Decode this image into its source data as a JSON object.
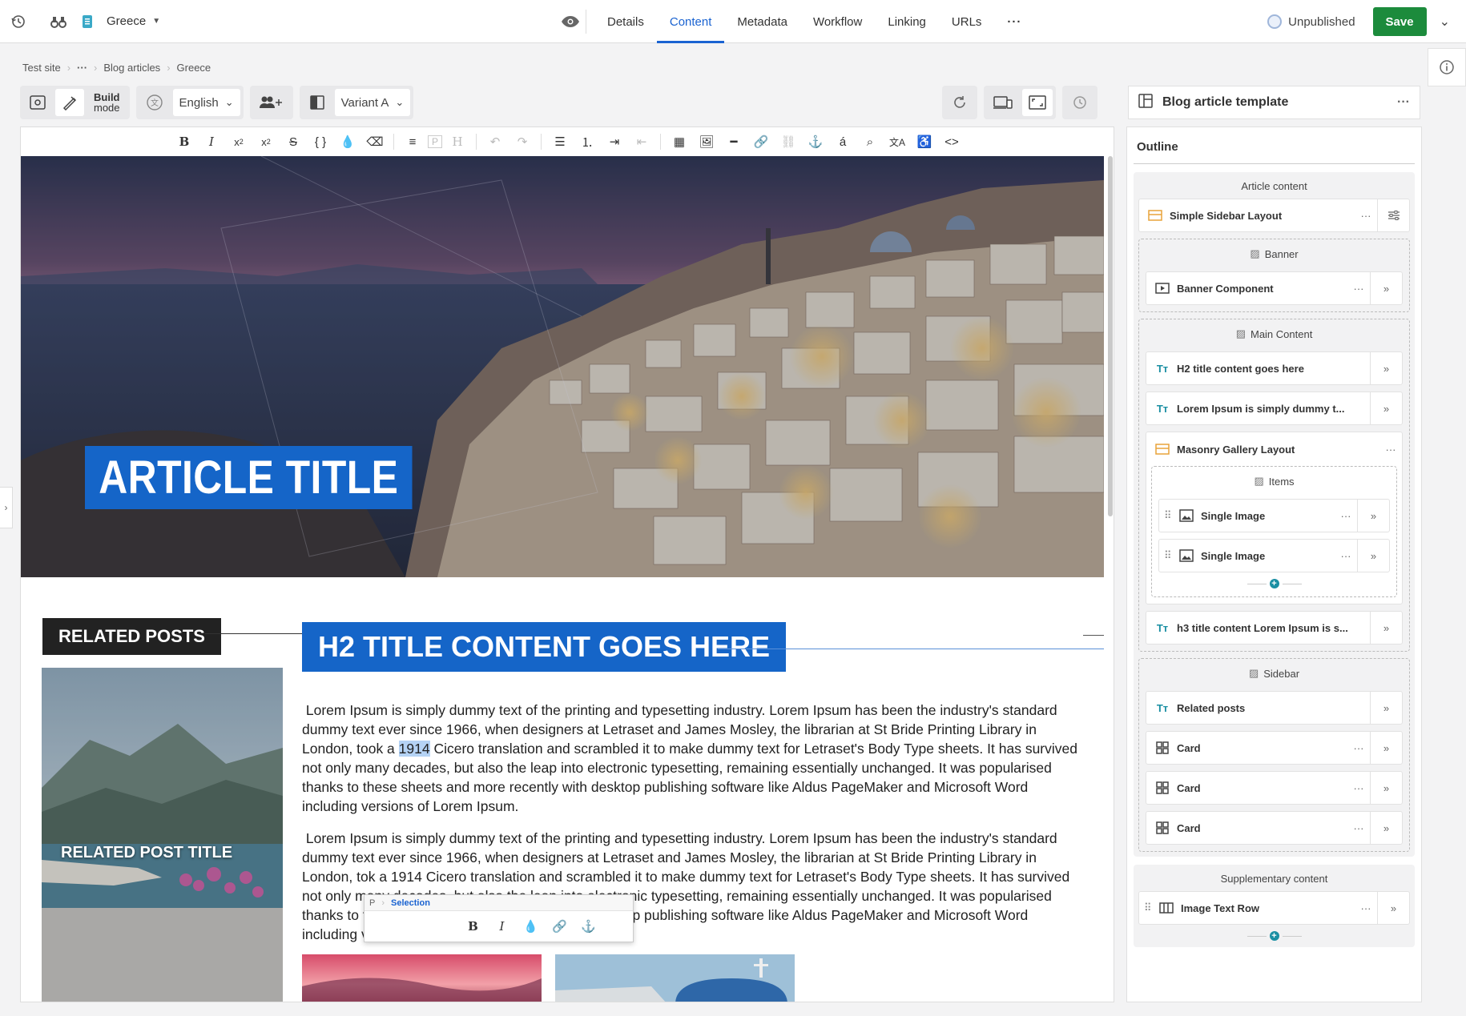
{
  "topbar": {
    "item_name": "Greece",
    "tabs": [
      "Details",
      "Content",
      "Metadata",
      "Workflow",
      "Linking",
      "URLs"
    ],
    "active_tab": "Content",
    "status": "Unpublished",
    "save_label": "Save"
  },
  "breadcrumb": [
    "Test site",
    "Blog articles",
    "Greece"
  ],
  "controls": {
    "build_mode_label_1": "Build",
    "build_mode_label_2": "mode",
    "language": "English",
    "variant": "Variant A"
  },
  "template": {
    "title": "Blog article template",
    "outline_title": "Outline"
  },
  "outline": {
    "article_content": "Article content",
    "layout": "Simple Sidebar Layout",
    "banner_zone": "Banner",
    "banner_component": "Banner Component",
    "main_zone": "Main Content",
    "main_items": [
      "H2 title content goes here",
      "Lorem Ipsum is simply dummy t..."
    ],
    "gallery": "Masonry Gallery Layout",
    "items_zone": "Items",
    "gallery_items": [
      "Single Image",
      "Single Image"
    ],
    "h3_item": "h3 title content Lorem Ipsum is s...",
    "sidebar_zone": "Sidebar",
    "related": "Related posts",
    "cards": [
      "Card",
      "Card",
      "Card"
    ],
    "supplementary": "Supplementary content",
    "image_text_row": "Image Text Row"
  },
  "canvas": {
    "article_title": "ARTICLE TITLE",
    "related_heading": "RELATED POSTS",
    "related_post_title": "RELATED POST TITLE",
    "h2_title": "H2 TITLE CONTENT GOES HERE",
    "p1_before": "Lorem Ipsum is simply dummy text of the printing and typesetting industry. Lorem Ipsum has been the industry's standard dummy text ever since 1966, when designers at Letraset and James Mosley, the librarian at St Bride Printing Library in London, took a ",
    "p1_highlight": "1914",
    "p1_after": " Cicero translation and scrambled it to make dummy text for Letraset's Body Type sheets. It has survived not only many decades, but also the leap into electronic typesetting, remaining essentially unchanged. It was popularised thanks to these sheets and more recently with desktop publishing software like Aldus PageMaker and Microsoft Word including versions of Lorem Ipsum.",
    "p2": "Lorem Ipsum is simply dummy text of the printing and typesetting industry. Lorem Ipsum has been the industry's standard dummy text ever since 1966, when designers at Letraset and James Mosley, the librarian at St Bride Printing Library in London, tok a 1914 Cicero translation and scrambled it to make dummy text for Letraset's Body Type sheets. It has survived not only many decades, but also the leap into electronic typesetting, remaining essentially unchanged. It was popularised thanks to these sheets and more recently with desktop publishing software like Aldus PageMaker and Microsoft Word including versions of Lorem Ipsum.",
    "popup_tag": "P",
    "popup_selection": "Selection"
  },
  "colors": {
    "accent": "#1a63d1",
    "title_bg": "#1565c8",
    "save_green": "#1c8b3c"
  }
}
